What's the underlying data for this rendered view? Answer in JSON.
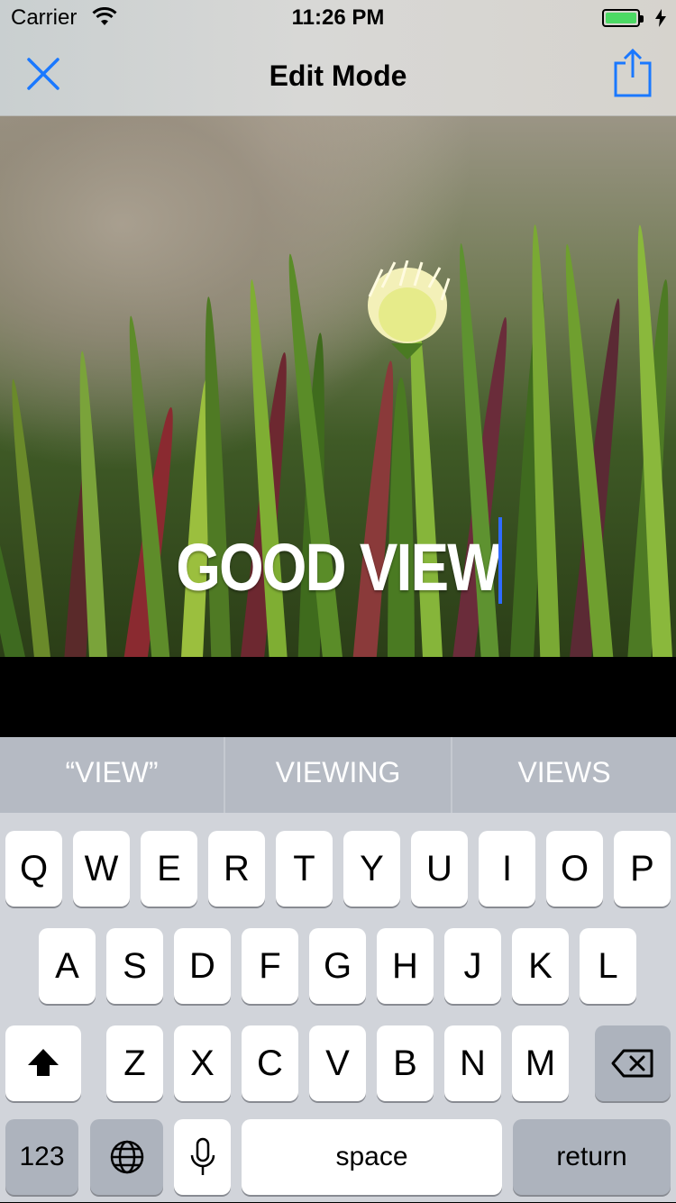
{
  "status": {
    "carrier": "Carrier",
    "time": "11:26 PM",
    "battery_level": 0.85,
    "battery_color": "#4cd964"
  },
  "nav": {
    "title": "Edit Mode",
    "close_icon": "close-icon",
    "share_icon": "share-icon",
    "accent": "#1a78ff"
  },
  "photo": {
    "overlay_text": "GOOD VIEW"
  },
  "keyboard": {
    "predictions": [
      "“VIEW”",
      "VIEWING",
      "VIEWS"
    ],
    "row1": [
      "Q",
      "W",
      "E",
      "R",
      "T",
      "Y",
      "U",
      "I",
      "O",
      "P"
    ],
    "row2": [
      "A",
      "S",
      "D",
      "F",
      "G",
      "H",
      "J",
      "K",
      "L"
    ],
    "row3": [
      "Z",
      "X",
      "C",
      "V",
      "B",
      "N",
      "M"
    ],
    "numbers_label": "123",
    "space_label": "space",
    "return_label": "return"
  }
}
